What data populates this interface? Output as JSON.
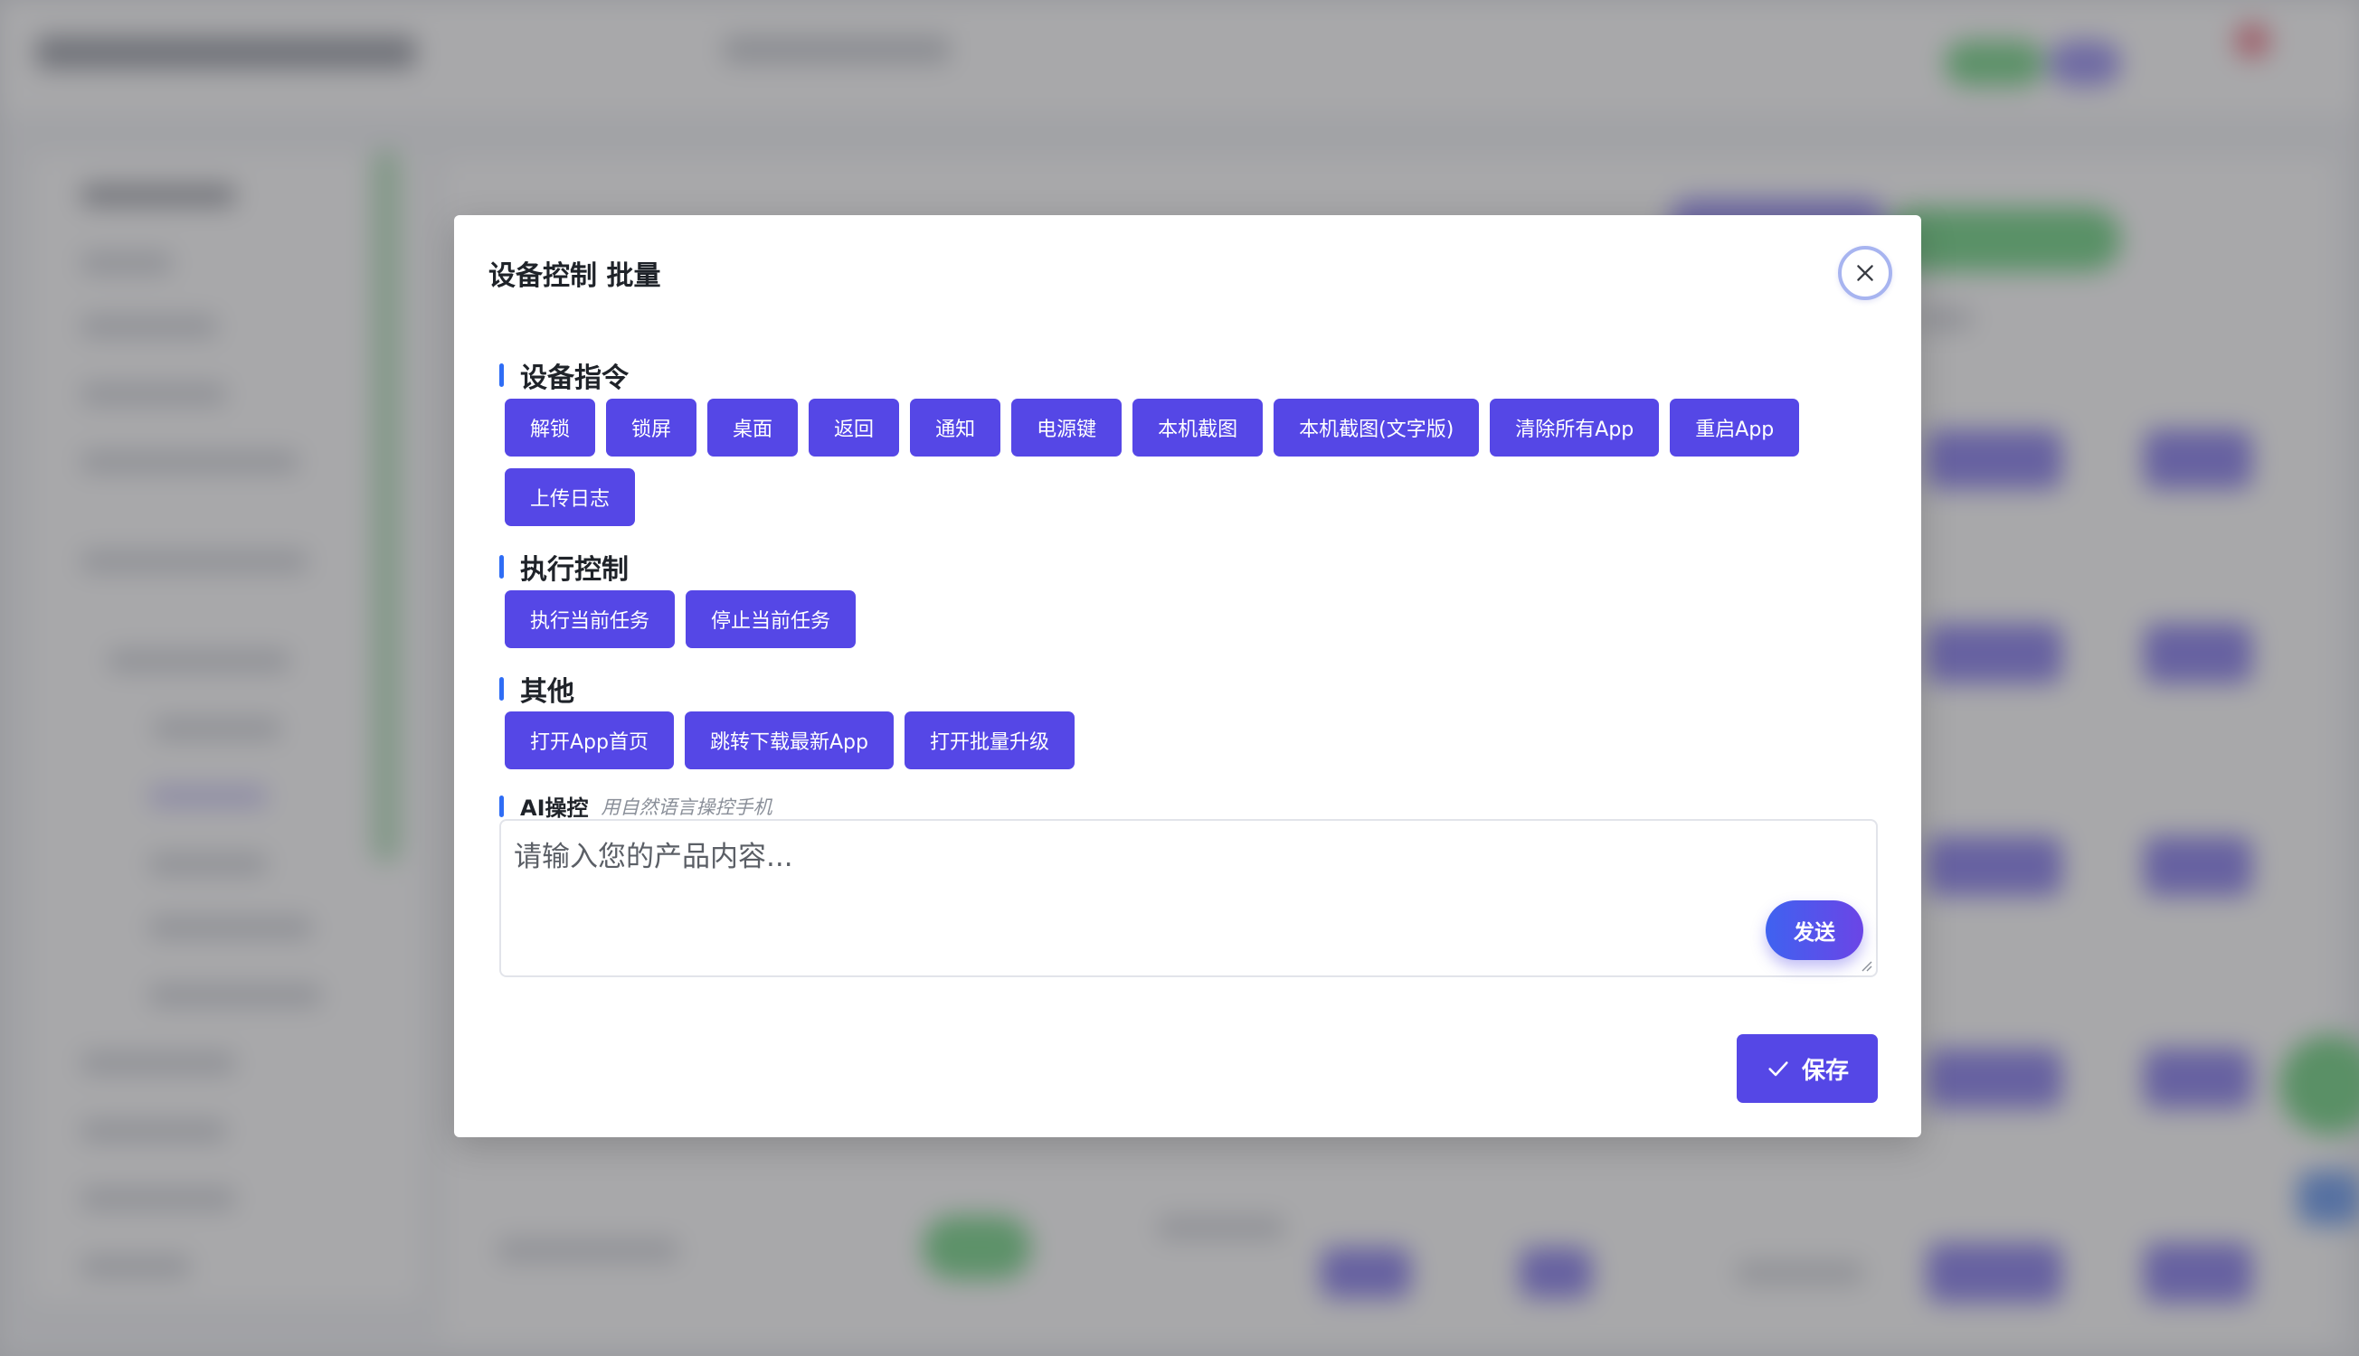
{
  "modal": {
    "title": "设备控制 批量"
  },
  "sections": {
    "device": {
      "label": "设备指令",
      "buttons": [
        "解锁",
        "锁屏",
        "桌面",
        "返回",
        "通知",
        "电源键",
        "本机截图",
        "本机截图(文字版)",
        "清除所有App",
        "重启App",
        "上传日志"
      ]
    },
    "exec": {
      "label": "执行控制",
      "buttons": [
        "执行当前任务",
        "停止当前任务"
      ]
    },
    "other": {
      "label": "其他",
      "buttons": [
        "打开App首页",
        "跳转下载最新App",
        "打开批量升级"
      ]
    },
    "ai": {
      "label": "AI操控",
      "hint": "用自然语言操控手机",
      "placeholder": "请输入您的产品内容...",
      "send_label": "发送"
    }
  },
  "footer": {
    "save_label": "保存"
  },
  "colors": {
    "primary": "#5547e6",
    "accent_bar": "#2f6df5",
    "send_gradient_start": "#3f62f0",
    "send_gradient_end": "#6b45e6"
  },
  "icons": {
    "close": "close-icon",
    "check": "check-icon"
  }
}
